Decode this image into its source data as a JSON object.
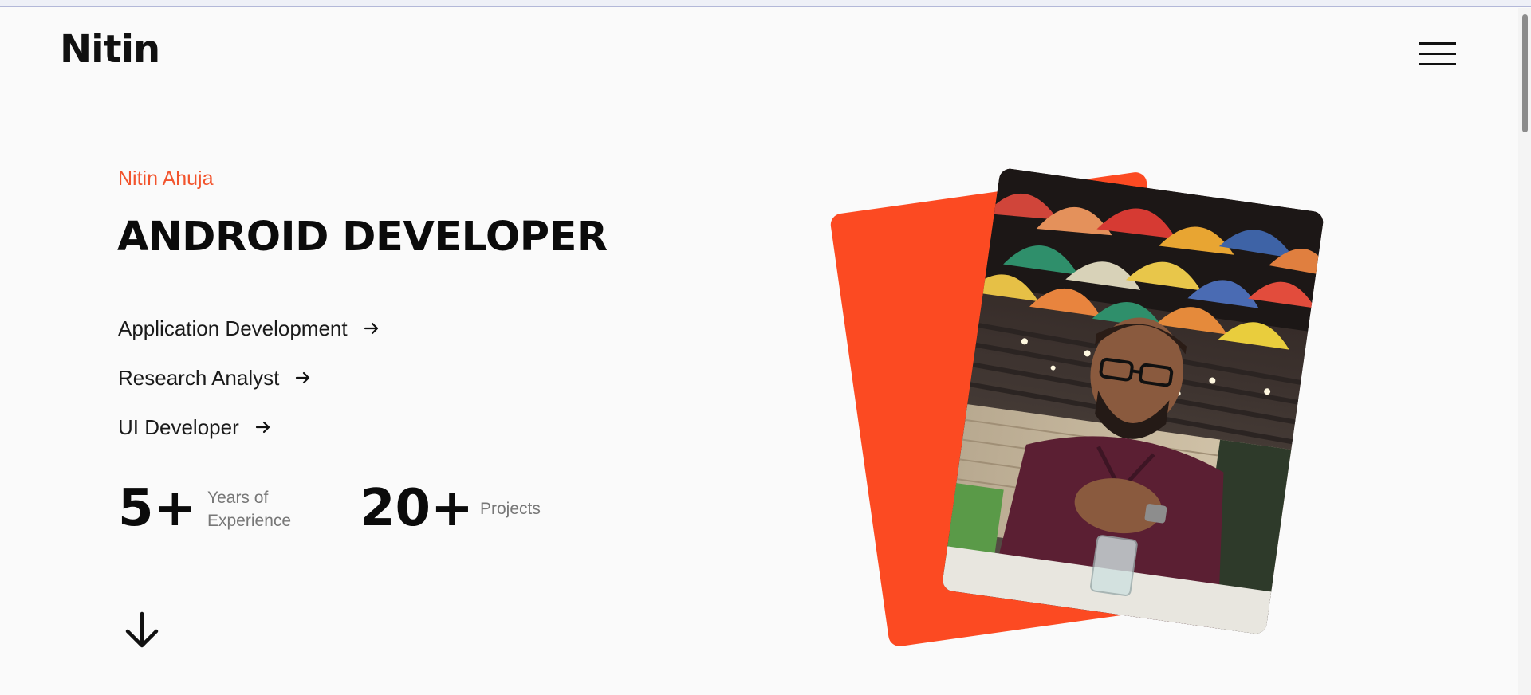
{
  "header": {
    "logo": "Nitin",
    "menu_icon": "hamburger-menu-icon"
  },
  "hero": {
    "name": "Nitin Ahuja",
    "title": "ANDROID DEVELOPER",
    "services": [
      {
        "label": "Application Development",
        "icon": "arrow-right-icon"
      },
      {
        "label": "Research Analyst",
        "icon": "arrow-right-icon"
      },
      {
        "label": "UI Developer",
        "icon": "arrow-right-icon"
      }
    ],
    "stats": [
      {
        "value": "5+",
        "label": "Years of Experience"
      },
      {
        "value": "20+",
        "label": "Projects"
      }
    ],
    "scroll_icon": "arrow-down-icon"
  },
  "colors": {
    "accent": "#fc4a22",
    "name_color": "#f2542d",
    "background": "#fafafa",
    "text": "#0b0b0b"
  }
}
